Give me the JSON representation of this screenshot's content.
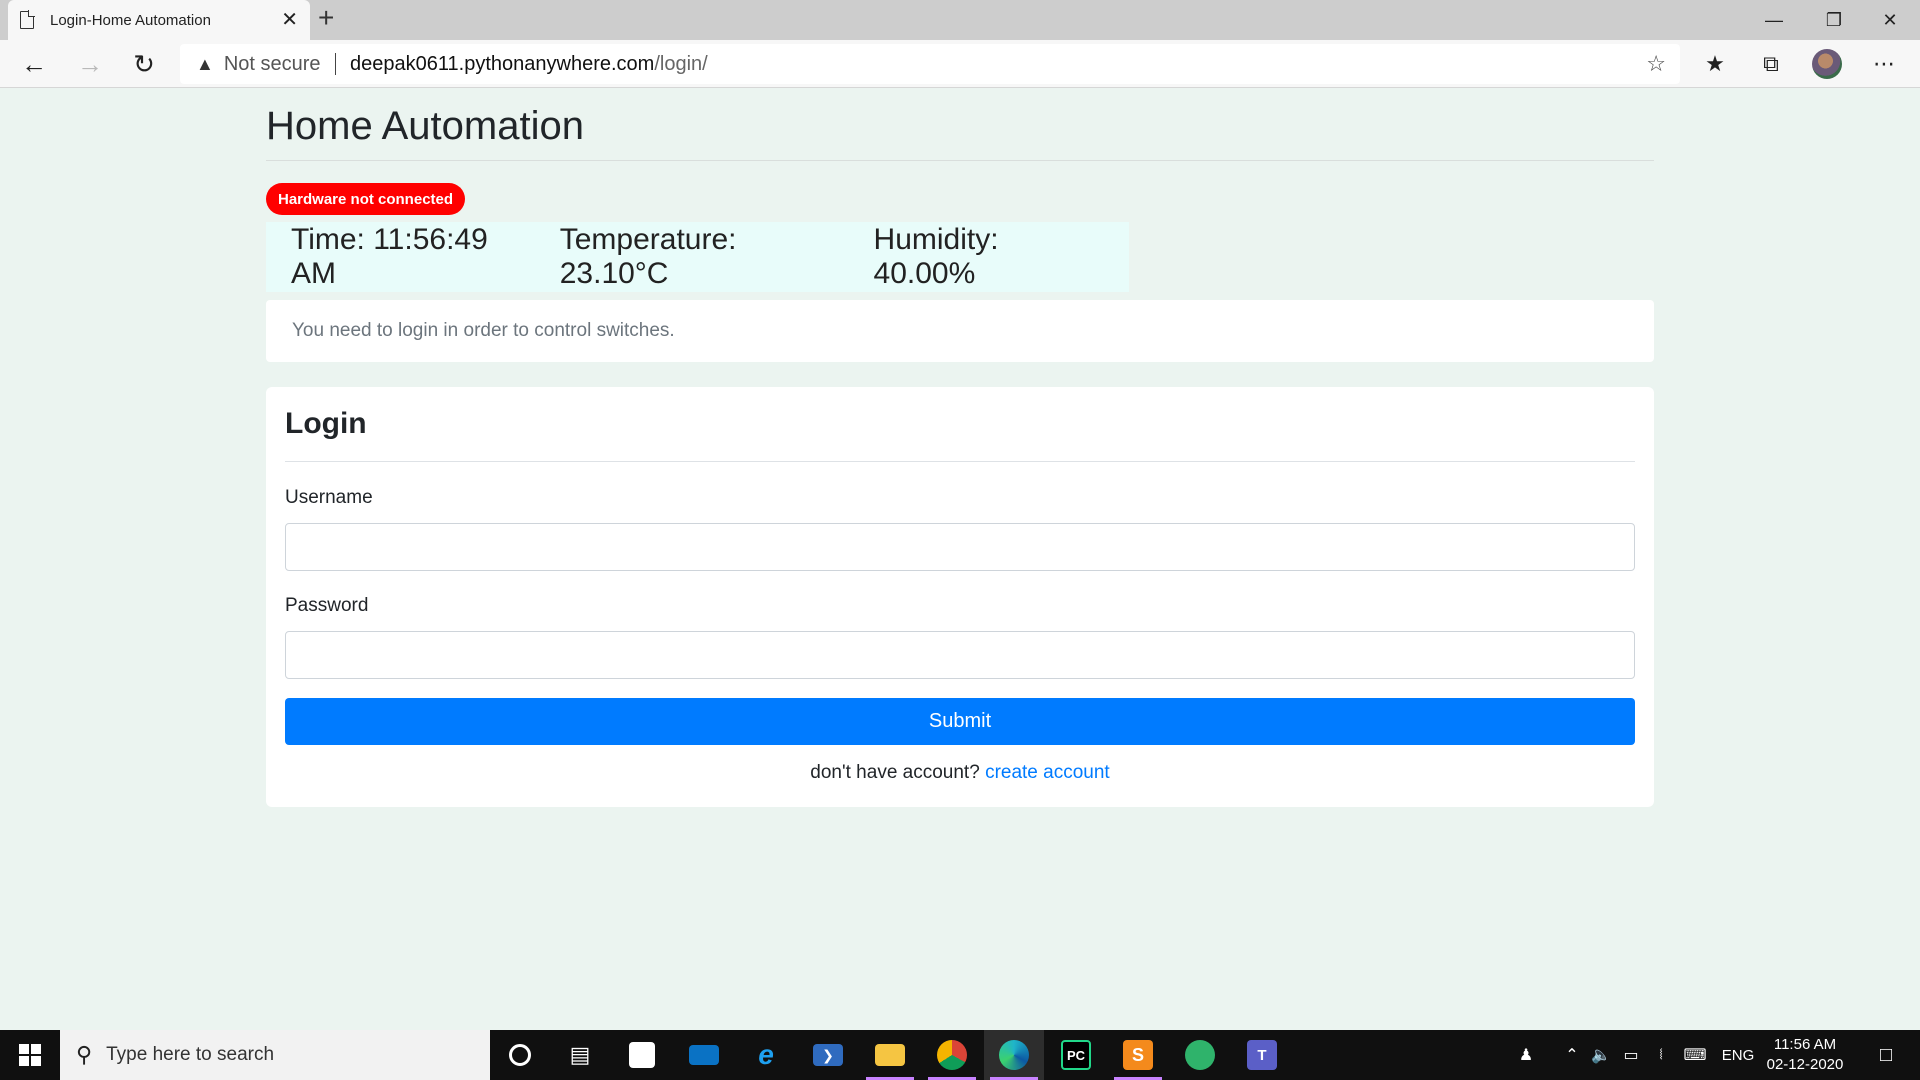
{
  "browser": {
    "tab_title": "Login-Home Automation",
    "new_tab": "+",
    "security_label": "Not secure",
    "url_host": "deepak0611.pythonanywhere.com",
    "url_path": "/login/"
  },
  "page": {
    "title": "Home Automation",
    "hardware_status": "Hardware not connected",
    "status_color": "#ff0000",
    "time": "Time: 11:56:49 AM",
    "temperature": "Temperature: 23.10°C",
    "humidity": "Humidity: 40.00%",
    "notice": "You need to login in order to control switches."
  },
  "login": {
    "title": "Login",
    "username_label": "Username",
    "username_value": "",
    "password_label": "Password",
    "password_value": "",
    "submit_label": "Submit",
    "signup_prompt": "don't have account?",
    "signup_link": "create account",
    "accent_color": "#007bff"
  },
  "taskbar": {
    "search_placeholder": "Type here to search",
    "language": "ENG",
    "time": "11:56 AM",
    "date": "02-12-2020"
  }
}
